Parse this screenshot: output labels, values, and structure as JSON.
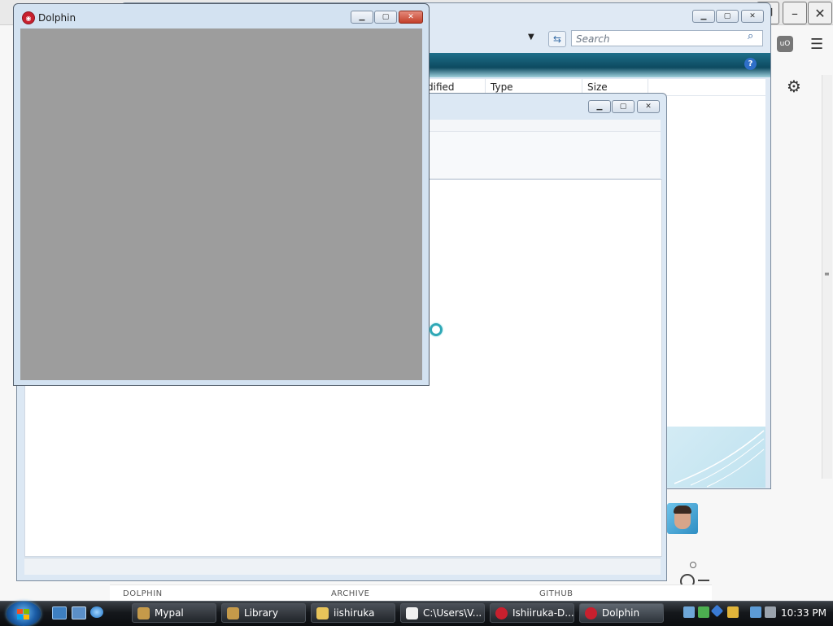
{
  "background_browser": {
    "extension_label": "uO",
    "bottom_labels": [
      "DOLPHIN",
      "ARCHIVE",
      "GITHUB"
    ]
  },
  "explorer": {
    "search_placeholder": "Search",
    "columns": [
      "dified",
      "Type",
      "Size"
    ]
  },
  "dolphin": {
    "title": "Dolphin"
  },
  "taskbar": {
    "items": [
      {
        "label": "Mypal",
        "icon": "mypal-icon"
      },
      {
        "label": "Library",
        "icon": "mypal-icon"
      },
      {
        "label": "iishiruka",
        "icon": "folder-icon"
      },
      {
        "label": "C:\\Users\\V...",
        "icon": "7zip-icon"
      },
      {
        "label": "Ishiiruka-D...",
        "icon": "dolphin-icon"
      },
      {
        "label": "Dolphin",
        "icon": "dolphin-icon"
      }
    ],
    "clock": "10:33 PM"
  }
}
